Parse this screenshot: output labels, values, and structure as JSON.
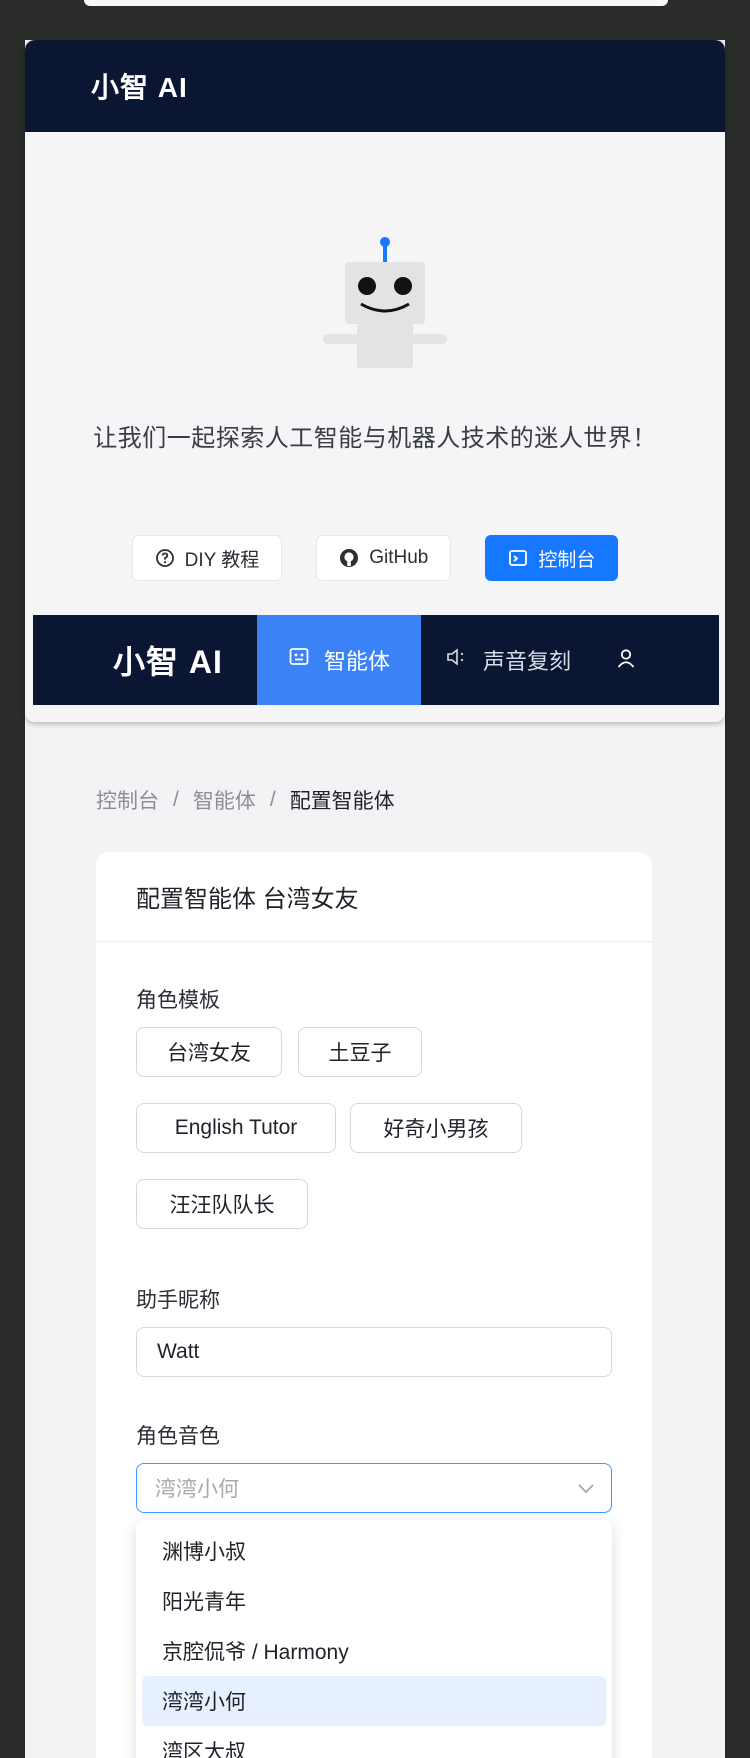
{
  "hero": {
    "brand": "小智 AI",
    "slogan": "让我们一起探索人工智能与机器人技术的迷人世界！",
    "buttons": [
      {
        "label": "DIY 教程",
        "icon": "question-circle-icon"
      },
      {
        "label": "GitHub",
        "icon": "github-icon"
      },
      {
        "label": "控制台",
        "icon": "terminal-icon"
      }
    ]
  },
  "nav": {
    "brand": "小智 AI",
    "items": [
      {
        "label": "智能体",
        "icon": "robot-icon",
        "active": true
      },
      {
        "label": "声音复刻",
        "icon": "speaker-icon",
        "active": false
      }
    ],
    "user_icon": "user-icon"
  },
  "breadcrumb": {
    "items": [
      "控制台",
      "智能体",
      "配置智能体"
    ],
    "separator": "/"
  },
  "config": {
    "title": "配置智能体 台湾女友",
    "template_label": "角色模板",
    "templates": [
      "台湾女友",
      "土豆子",
      "English Tutor",
      "好奇小男孩",
      "汪汪队队长"
    ],
    "nickname_label": "助手昵称",
    "nickname_value": "Watt",
    "voice_label": "角色音色",
    "voice_placeholder": "湾湾小何",
    "voice_options": [
      "渊博小叔",
      "阳光青年",
      "京腔侃爷 / Harmony",
      "湾湾小何",
      "湾区大叔"
    ],
    "voice_selected_index": 3
  },
  "colors": {
    "nav_bg": "#0b1633",
    "accent": "#1677ff",
    "nav_active": "#3b82f6",
    "selected_option": "#e6f0ff"
  }
}
